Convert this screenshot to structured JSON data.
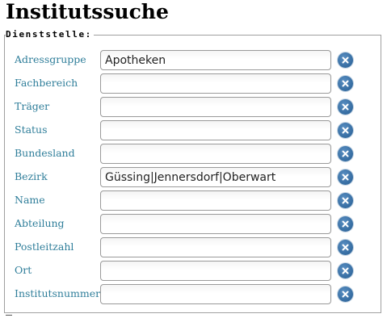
{
  "page": {
    "title": "Institutssuche"
  },
  "form": {
    "legend": "Dienststelle:",
    "fields": [
      {
        "label": "Adressgruppe",
        "value": "Apotheken"
      },
      {
        "label": "Fachbereich",
        "value": ""
      },
      {
        "label": "Träger",
        "value": ""
      },
      {
        "label": "Status",
        "value": ""
      },
      {
        "label": "Bundesland",
        "value": ""
      },
      {
        "label": "Bezirk",
        "value": "Güssing|Jennersdorf|Oberwart"
      },
      {
        "label": "Name",
        "value": ""
      },
      {
        "label": "Abteilung",
        "value": ""
      },
      {
        "label": "Postleitzahl",
        "value": ""
      },
      {
        "label": "Ort",
        "value": ""
      },
      {
        "label": "Institutsnummer",
        "value": ""
      }
    ],
    "clear_icon": "close-circle-icon"
  },
  "colors": {
    "label": "#2f7e9a",
    "clear_button": "#245c92"
  }
}
